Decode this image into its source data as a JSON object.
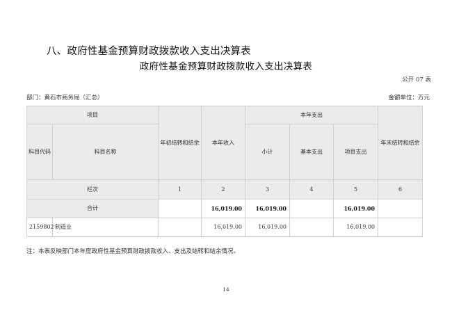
{
  "section_title": "八、政府性基金预算财政拨款收入支出决算表",
  "table_title": "政府性基金预算财政拨款收入支出决算表",
  "form_no": "公开 07 表",
  "department": "部门：黄石市商务局（汇总）",
  "unit": "金额单位：万元",
  "header": {
    "item": "项目",
    "subject_code": "科目代码",
    "subject_name": "科目名称",
    "opening_balance": "年初结转和结余",
    "current_income": "本年收入",
    "current_expense": "本年支出",
    "subtotal": "小计",
    "basic_expense": "基本支出",
    "project_expense": "项目支出",
    "closing_balance": "年末结转和结余"
  },
  "column_index": {
    "label": "栏次",
    "numbers": [
      "1",
      "2",
      "3",
      "4",
      "5",
      "6"
    ]
  },
  "total_row": {
    "label": "合计",
    "opening_balance": "",
    "current_income": "16,019.00",
    "subtotal": "16,019.00",
    "basic_expense": "",
    "project_expense": "16,019.00",
    "closing_balance": ""
  },
  "rows": [
    {
      "code": "2159802",
      "name": "制造业",
      "opening_balance": "",
      "current_income": "16,019.00",
      "subtotal": "16,019.00",
      "basic_expense": "",
      "project_expense": "16,019.00",
      "closing_balance": ""
    }
  ],
  "note": "注：本表反映部门本年度政府性基金预算财政拨款收入、支出及结转和结余情况。",
  "page_number": "14"
}
